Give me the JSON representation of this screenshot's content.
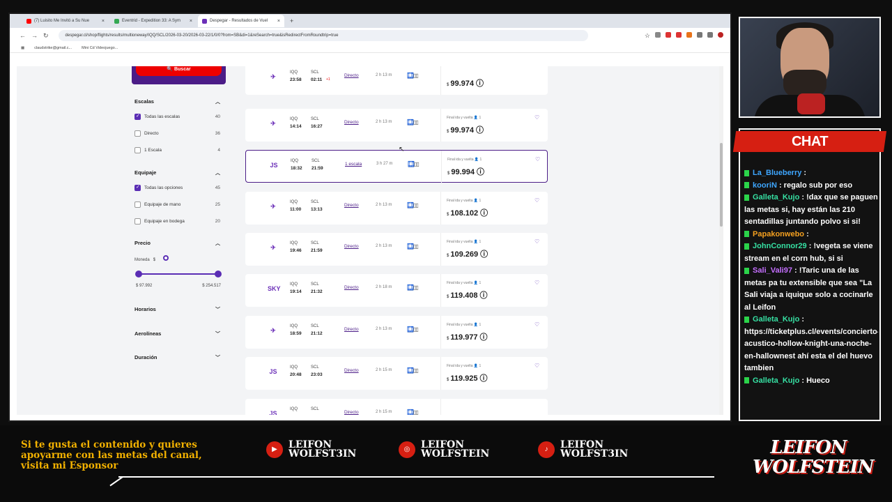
{
  "browser": {
    "tabs": [
      {
        "title": "(7) Luisito Me Invitó a Su Nue",
        "color": "#ff0000"
      },
      {
        "title": "Eventrid - Expedition 33: A Sym",
        "color": "#34a853"
      },
      {
        "title": "Despegar - Resultados de Vuel",
        "color": "#6b2fb8"
      }
    ],
    "new_tab": "+",
    "url": "despegar.cl/shop/flights/results/multioneway/IQQ/SCL/2026-03-20/2026-03-22/1/0/0?from=SB&di=1&reSearch=true&isRedirectFromRoundtrip=true",
    "bookmarks": [
      "claudstrike@gmail.c...",
      "Mini Cd Videojuego..."
    ]
  },
  "sidebar": {
    "search_button": "Buscar",
    "escalas": {
      "title": "Escalas",
      "options": [
        {
          "label": "Todas las escalas",
          "count": "40",
          "checked": true
        },
        {
          "label": "Directo",
          "count": "36",
          "checked": false
        },
        {
          "label": "1 Escala",
          "count": "4",
          "checked": false
        }
      ]
    },
    "equipaje": {
      "title": "Equipaje",
      "options": [
        {
          "label": "Todas las opciones",
          "count": "45",
          "checked": true
        },
        {
          "label": "Equipaje de mano",
          "count": "25",
          "checked": false
        },
        {
          "label": "Equipaje en bodega",
          "count": "20",
          "checked": false
        }
      ]
    },
    "precio": {
      "title": "Precio",
      "moneda": "Moneda",
      "currency": "$",
      "min": "$ 97.992",
      "max": "$ 254.517"
    },
    "horarios": "Horarios",
    "aerolineas": "Aerolíneas",
    "duracion": "Duración"
  },
  "flights": [
    {
      "logo": "✈",
      "from": "IQQ",
      "dep": "23:58",
      "to": "SCL",
      "arr": "02:11",
      "plus": "+1",
      "stops": "Directo",
      "dur": "2 h 13 m",
      "final": "",
      "price": "99.974"
    },
    {
      "logo": "✈",
      "from": "IQQ",
      "dep": "14:14",
      "to": "SCL",
      "arr": "16:27",
      "plus": "",
      "stops": "Directo",
      "dur": "2 h 13 m",
      "final": "Final ida y vuelta",
      "price": "99.974"
    },
    {
      "logo": "JS",
      "from": "IQQ",
      "dep": "18:32",
      "to": "SCL",
      "arr": "21:59",
      "plus": "",
      "stops": "1 escala",
      "dur": "3 h 27 m",
      "final": "Final ida y vuelta",
      "price": "99.994"
    },
    {
      "logo": "✈",
      "from": "IQQ",
      "dep": "11:00",
      "to": "SCL",
      "arr": "13:13",
      "plus": "",
      "stops": "Directo",
      "dur": "2 h 13 m",
      "final": "Final ida y vuelta",
      "price": "108.102"
    },
    {
      "logo": "✈",
      "from": "IQQ",
      "dep": "19:46",
      "to": "SCL",
      "arr": "21:59",
      "plus": "",
      "stops": "Directo",
      "dur": "2 h 13 m",
      "final": "Final ida y vuelta",
      "price": "109.269"
    },
    {
      "logo": "SKY",
      "from": "IQQ",
      "dep": "19:14",
      "to": "SCL",
      "arr": "21:32",
      "plus": "",
      "stops": "Directo",
      "dur": "2 h 18 m",
      "final": "Final ida y vuelta",
      "price": "119.408"
    },
    {
      "logo": "✈",
      "from": "IQQ",
      "dep": "18:59",
      "to": "SCL",
      "arr": "21:12",
      "plus": "",
      "stops": "Directo",
      "dur": "2 h 13 m",
      "final": "Final ida y vuelta",
      "price": "119.977"
    },
    {
      "logo": "JS",
      "from": "IQQ",
      "dep": "20:48",
      "to": "SCL",
      "arr": "23:03",
      "plus": "",
      "stops": "Directo",
      "dur": "2 h 15 m",
      "final": "Final ida y vuelta",
      "price": "119.925"
    },
    {
      "logo": "JS",
      "from": "IQQ",
      "dep": "",
      "to": "SCL",
      "arr": "",
      "plus": "",
      "stops": "Directo",
      "dur": "2 h 15 m",
      "final": "",
      "price": ""
    }
  ],
  "passengers": "1",
  "chat": {
    "title": "CHAT",
    "messages": [
      {
        "user": "",
        "text": ""
      },
      {
        "user": "La_Blueberry",
        "text": ":"
      },
      {
        "user": "kooriN",
        "text": ": regalo sub por eso"
      },
      {
        "user": "Galleta_Kujo",
        "text": ": !dax que se paguen las metas si, hay están las 210 sentadillas juntando polvo si si!"
      },
      {
        "user": "Papakonwebo",
        "text": ":"
      },
      {
        "user": "JohnConnor29",
        "text": ": !vegeta se viene stream en el corn hub, si si"
      },
      {
        "user": "Sali_Vali97",
        "text": ": !Taric una de las metas pa tu extensible que sea \"La Sali viaja a iquique solo a cocinarle al Leifon"
      },
      {
        "user": "Galleta_Kujo",
        "text": ": https://ticketplus.cl/events/concierto-acustico-hollow-knight-una-noche-en-hallownest ahí esta el del huevo tambien"
      },
      {
        "user": "Galleta_Kujo",
        "text": ": Hueco"
      }
    ]
  },
  "footer": {
    "sponsor": "Si te gusta el contenido y quieres apoyarme con las metas del canal, visita mi Esponsor",
    "youtube": "LEIFON WOLFST3IN",
    "instagram": "LEIFON WOLFSTEIN",
    "tiktok": "LEIFON WOLFST3IN",
    "brand": "LEIFON WOLFSTEIN"
  }
}
